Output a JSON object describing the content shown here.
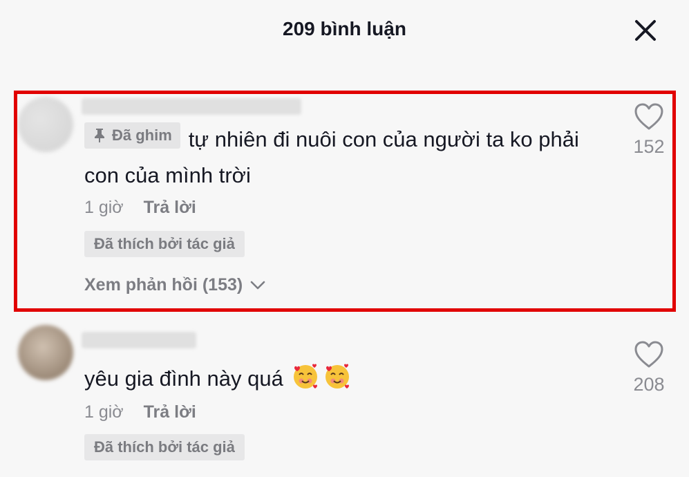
{
  "header": {
    "title": "209 bình luận",
    "close_icon": "close-icon"
  },
  "comments": [
    {
      "pinned_label": "Đã ghim",
      "text": "tự nhiên đi nuôi con của người ta ko phải con của mình trời",
      "time": "1 giờ",
      "reply_label": "Trả lời",
      "liked_by_author": "Đã thích bởi tác giả",
      "view_replies": "Xem phản hồi (153)",
      "like_count": "152"
    },
    {
      "text": "yêu gia đình này quá",
      "emojis": [
        "smiling-face-with-hearts",
        "smiling-face-with-hearts"
      ],
      "time": "1 giờ",
      "reply_label": "Trả lời",
      "liked_by_author": "Đã thích bởi tác giả",
      "like_count": "208"
    }
  ],
  "colors": {
    "highlight": "#e10000",
    "background": "#f7f7f7",
    "text": "#161823",
    "muted": "#8a8b91"
  }
}
